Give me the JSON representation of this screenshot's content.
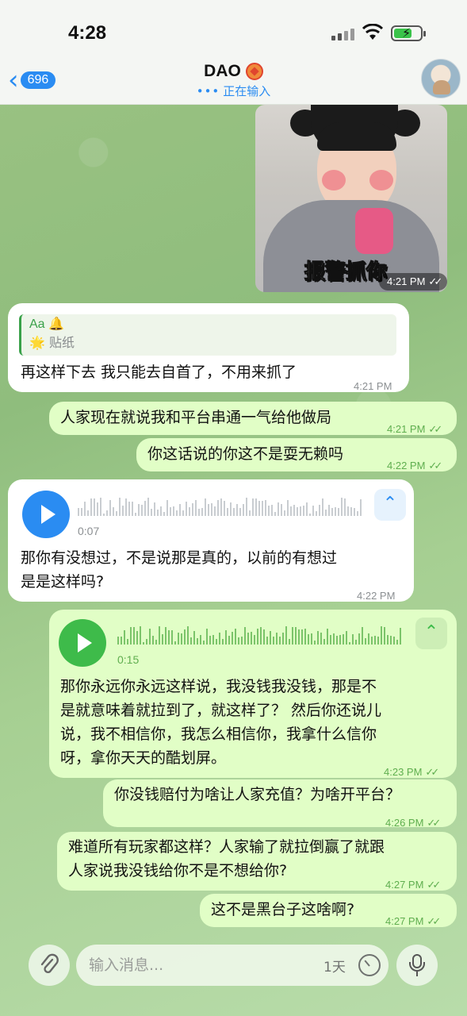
{
  "status_bar": {
    "time": "4:28"
  },
  "header": {
    "back_count": "696",
    "back_icon": "chevron-left-icon",
    "title": "DAO",
    "status": "正在输入",
    "status_dots": "•••"
  },
  "colors": {
    "incoming_bubble": "#ffffff",
    "outgoing_bubble": "#e1fec6",
    "accent": "#2a8cf2",
    "voice_in_button": "#2a8cf2",
    "voice_out_button": "#3ebb4a"
  },
  "messages": [
    {
      "type": "sticker",
      "direction": "out",
      "caption": "报警抓你",
      "time": "4:21 PM",
      "ticks": "✓✓"
    },
    {
      "type": "text",
      "direction": "in",
      "reply": {
        "name": "Aa 🔔",
        "text": "🌟 贴纸"
      },
      "text": "再这样下去 我只能去自首了，不用来抓了",
      "time": "4:21 PM"
    },
    {
      "type": "text",
      "direction": "out",
      "text": "人家现在就说我和平台串通一气给他做局",
      "time": "4:21 PM",
      "ticks": "✓✓"
    },
    {
      "type": "text",
      "direction": "out",
      "text": "你这话说的你这不是耍无赖吗",
      "time": "4:22 PM",
      "ticks": "✓✓"
    },
    {
      "type": "voice",
      "direction": "in",
      "duration": "0:07",
      "transcript_lines": [
        "那你有没想过，不是说那是真的，以前的有想过",
        "是是这样吗?"
      ],
      "time": "4:22 PM"
    },
    {
      "type": "voice",
      "direction": "out",
      "duration": "0:15",
      "transcript_lines": [
        "那你永远你永远这样说，我没钱我没钱，那是不",
        "是就意味着就拉到了，就这样了？ 然后你还说儿",
        "说，我不相信你，我怎么相信你，我拿什么信你",
        "呀，拿你天天的酷划屏。"
      ],
      "time": "4:23 PM",
      "ticks": "✓✓"
    },
    {
      "type": "text",
      "direction": "out",
      "text": "你没钱赔付为啥让人家充值？为啥开平台？",
      "time": "4:26 PM",
      "ticks": "✓✓"
    },
    {
      "type": "text",
      "direction": "out",
      "lines": [
        "难道所有玩家都这样？人家输了就拉倒赢了就跟",
        "人家说我没钱给你不是不想给你?"
      ],
      "time": "4:27 PM",
      "ticks": "✓✓"
    },
    {
      "type": "text",
      "direction": "out",
      "text": "这不是黑台子这啥啊?",
      "time": "4:27 PM",
      "ticks": "✓✓"
    }
  ],
  "input_bar": {
    "placeholder": "输入消息...",
    "timer_label": "1天",
    "attach_icon": "paperclip-icon",
    "timer_icon": "clock-icon",
    "mic_icon": "microphone-icon"
  }
}
